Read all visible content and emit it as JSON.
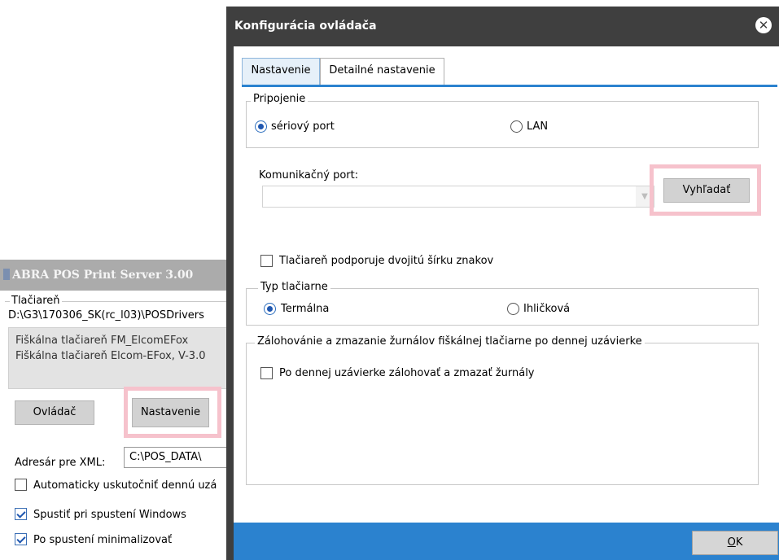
{
  "background_window": {
    "title": "ABRA POS Print Server 3.00",
    "printers_group_label": "Tlačiareň",
    "printer_path": "D:\\G3\\170306_SK(rc_l03)\\POSDrivers",
    "printer_list": [
      "Fiškálna tlačiareň FM_ElcomEFox",
      "Fiškálna tlačiareň Elcom-EFox, V-3.0"
    ],
    "driver_button": "Ovládač",
    "settings_button": "Nastavenie",
    "xml_dir_label": "Adresár pre XML:",
    "xml_dir_value": "C:\\POS_DATA\\",
    "checkboxes": [
      {
        "label": "Automaticky uskutočniť dennú uzá",
        "checked": false
      },
      {
        "label": "Spustiť pri spustení Windows",
        "checked": true
      },
      {
        "label": "Po spustení minimalizovať",
        "checked": true
      }
    ]
  },
  "dialog": {
    "title": "Konfigurácia ovládača",
    "close_icon": "close-circle-icon",
    "tabs": [
      {
        "label": "Nastavenie",
        "active": true
      },
      {
        "label": "Detailné nastavenie",
        "active": false
      }
    ],
    "connection": {
      "legend": "Pripojenie",
      "options": [
        {
          "label": "sériový port",
          "selected": true
        },
        {
          "label": "LAN",
          "selected": false
        }
      ]
    },
    "port": {
      "label": "Komunikačný port:",
      "value": "",
      "search_button": "Vyhľadať"
    },
    "double_width": {
      "label": "Tlačiareň podporuje dvojitú šírku znakov",
      "checked": false
    },
    "printer_type": {
      "legend": "Typ tlačiarne",
      "options": [
        {
          "label": "Termálna",
          "selected": true
        },
        {
          "label": "Ihličková",
          "selected": false
        }
      ]
    },
    "backup": {
      "legend": "Zálohovánie a zmazanie žurnálov fiškálnej tlačiarne po dennej uzávierke",
      "checkbox": {
        "label": "Po dennej uzávierke zálohovať a zmazať žurnály",
        "checked": false
      }
    },
    "ok_button": {
      "underlined": "O",
      "rest": "K"
    }
  },
  "colors": {
    "dialog_frame": "#3f3f3f",
    "accent_blue": "#2b82cf",
    "highlight_pink": "#f6c2cc"
  }
}
